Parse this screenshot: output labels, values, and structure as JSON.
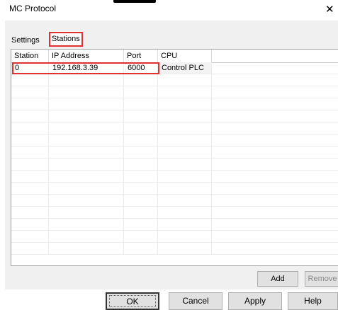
{
  "window": {
    "title": "MC Protocol",
    "close_glyph": "✕"
  },
  "tabs": [
    {
      "label": "Settings",
      "selected": false
    },
    {
      "label": "Stations",
      "selected": true
    }
  ],
  "list": {
    "columns": [
      "Station",
      "IP Address",
      "Port",
      "CPU"
    ],
    "rows": [
      {
        "station": "0",
        "ip": "192.168.3.39",
        "port": "6000",
        "cpu": "Control PLC"
      }
    ]
  },
  "list_buttons": {
    "add": "Add",
    "remove": "Remove"
  },
  "dialog_buttons": {
    "ok": "OK",
    "cancel": "Cancel",
    "apply": "Apply",
    "help": "Help"
  },
  "colors": {
    "highlight": "#e03030",
    "panel": "#f0f0f0"
  }
}
